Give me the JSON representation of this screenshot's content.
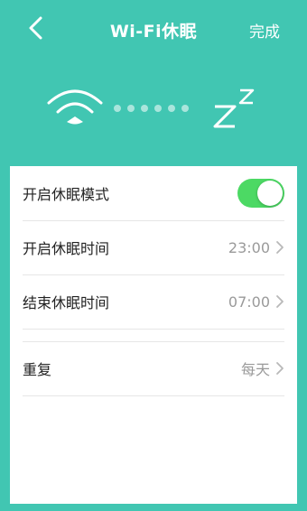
{
  "header": {
    "title": "Wi-Fi休眠",
    "done_label": "完成"
  },
  "hero": {
    "wifi_icon": "wifi-icon",
    "sleep_icon": "zz-icon",
    "dot_count": 6
  },
  "settings": {
    "sleep_mode": {
      "label": "开启休眠模式",
      "enabled": true
    },
    "start_time": {
      "label": "开启休眠时间",
      "value": "23:00"
    },
    "end_time": {
      "label": "结束休眠时间",
      "value": "07:00"
    },
    "repeat": {
      "label": "重复",
      "value": "每天"
    }
  },
  "colors": {
    "background": "#41c6b2",
    "toggle_on": "#4cd964",
    "value_text": "#9a9a9a"
  }
}
